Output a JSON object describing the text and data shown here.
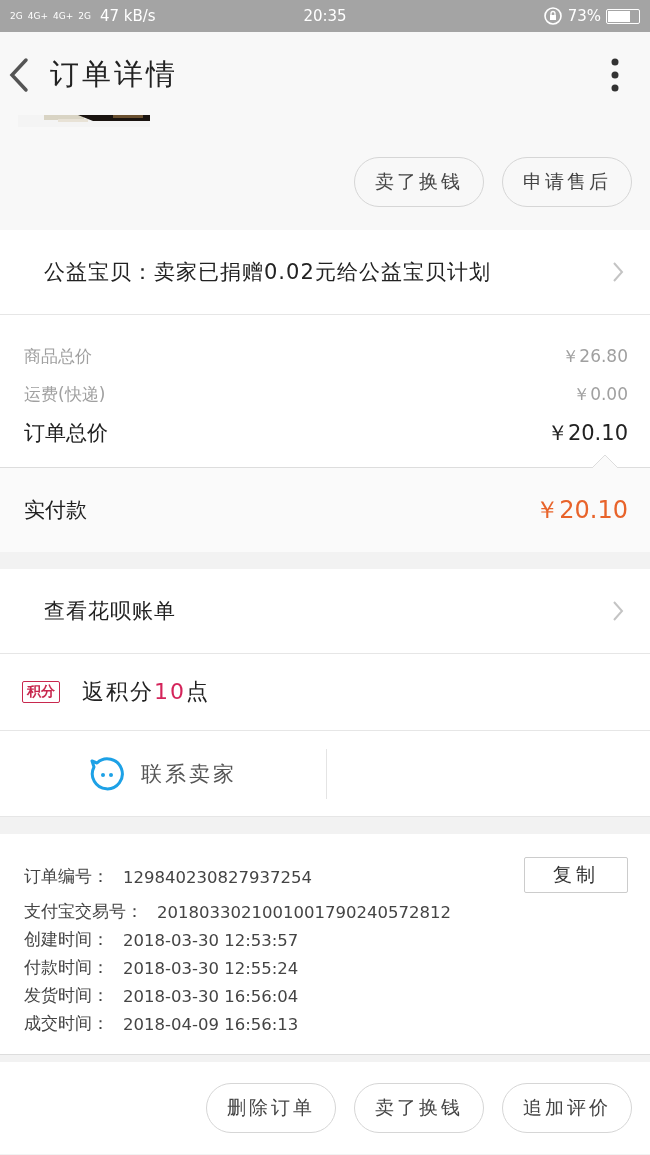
{
  "status_bar": {
    "network_labels": [
      "2G",
      "4G+",
      "4G+",
      "2G"
    ],
    "speed": "47 kB/s",
    "time": "20:35",
    "battery": "73%"
  },
  "header": {
    "title": "订单详情"
  },
  "product": {
    "kind": "picture"
  },
  "top_actions": [
    "卖了换钱",
    "申请售后"
  ],
  "charity": {
    "text": "公益宝贝：卖家已捐赠0.02元给公益宝贝计划"
  },
  "prices": [
    {
      "label": "商品总价",
      "value": "￥26.80",
      "kind": "minor"
    },
    {
      "label": "运费(快递)",
      "value": "￥0.00",
      "kind": "minor"
    },
    {
      "label": "订单总价",
      "value": "￥20.10",
      "kind": "major"
    }
  ],
  "paid": {
    "label": "实付款",
    "value": "￥20.10"
  },
  "huabei": {
    "label": "查看花呗账单"
  },
  "points": {
    "badge": "积分",
    "text_before": "返积分",
    "number": "10",
    "text_after": "点"
  },
  "contact": {
    "label": "联系卖家"
  },
  "order_info": {
    "copy_button": "复制",
    "rows": [
      {
        "label": "订单编号：",
        "value": "129840230827937254"
      },
      {
        "label": "支付宝交易号：",
        "value": "2018033021001001790240572812"
      },
      {
        "label": "创建时间：",
        "value": "2018-03-30 12:53:57"
      },
      {
        "label": "付款时间：",
        "value": "2018-03-30 12:55:24"
      },
      {
        "label": "发货时间：",
        "value": "2018-03-30 16:56:04"
      },
      {
        "label": "成交时间：",
        "value": "2018-04-09 16:56:13"
      }
    ]
  },
  "bottom_actions": [
    "删除订单",
    "卖了换钱",
    "追加评价"
  ]
}
